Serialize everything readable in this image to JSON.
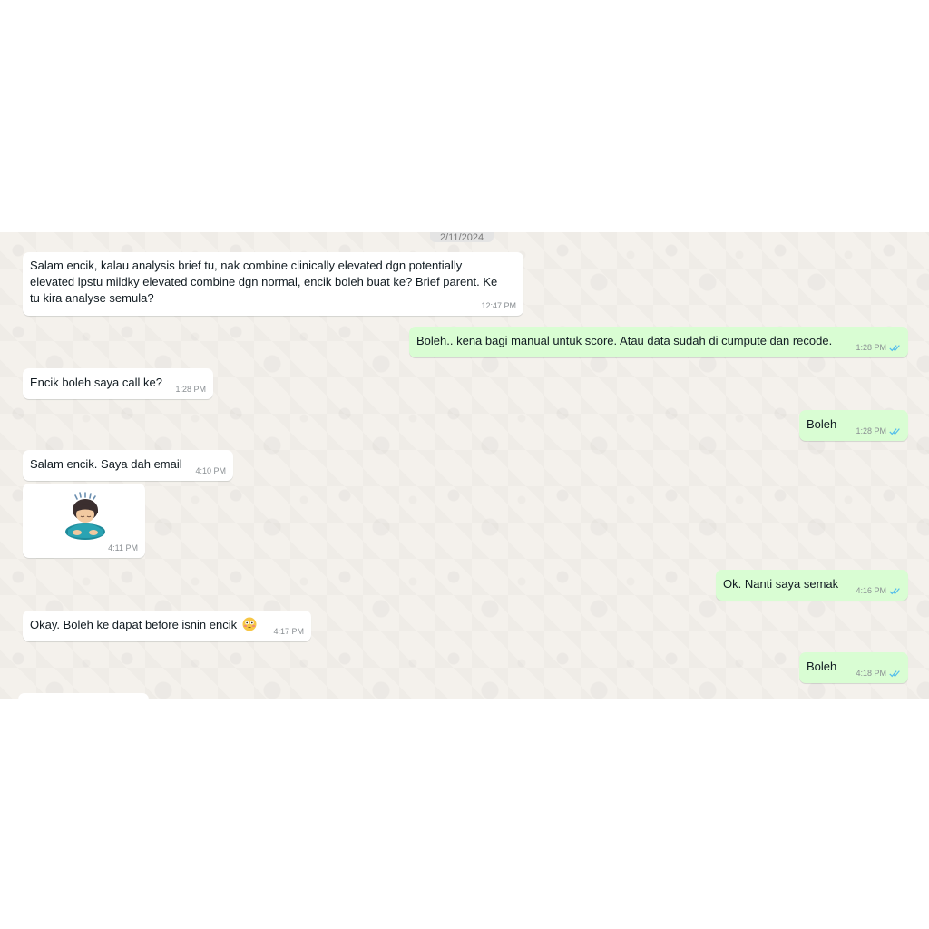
{
  "chat": {
    "date_chip": "2/11/2024",
    "messages": [
      {
        "dir": "in",
        "lines": [
          "Salam encik, kalau analysis brief tu, nak combine clinically elevated dgn potentially",
          "elevated lpstu mildky elevated combine dgn normal, encik boleh buat ke? Brief parent. Ke",
          "tu kira analyse semula?"
        ],
        "time": "12:47 PM"
      },
      {
        "dir": "out",
        "text": "Boleh.. kena bagi manual untuk score. Atau data sudah di cumpute dan recode.",
        "time": "1:28 PM",
        "status": "read"
      },
      {
        "dir": "in",
        "text": "Encik boleh saya call ke?",
        "time": "1:28 PM"
      },
      {
        "dir": "out",
        "text": "Boleh",
        "time": "1:28 PM",
        "status": "read"
      },
      {
        "dir": "in",
        "text": "Salam encik. Saya dah email",
        "time": "4:10 PM"
      },
      {
        "dir": "in",
        "sticker": "person-bowing-sticker",
        "time": "4:11 PM"
      },
      {
        "dir": "out",
        "text": "Ok. Nanti saya semak",
        "time": "4:16 PM",
        "status": "read"
      },
      {
        "dir": "in",
        "text": "Okay. Boleh ke dapat before isnin encik",
        "emoji": "flushed-face-emoji",
        "time": "4:17 PM"
      },
      {
        "dir": "out",
        "text": "Boleh",
        "time": "4:18 PM",
        "status": "read"
      }
    ]
  },
  "colors": {
    "incoming_bubble": "#ffffff",
    "outgoing_bubble": "#d9fdd3",
    "read_ticks": "#53bdeb",
    "chat_background": "#efeae2"
  }
}
